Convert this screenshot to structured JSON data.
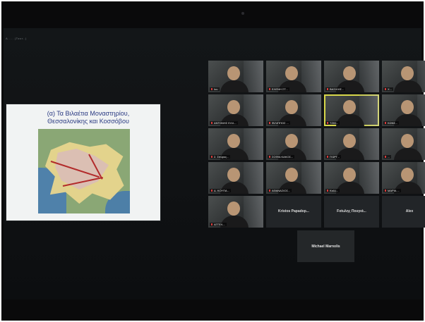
{
  "window": {
    "top_text": "Α..... (Ταυτ..)"
  },
  "shared_screen": {
    "slide_title": "(α) Τα Βιλαέτια Μοναστηρίου, Θεσσαλονίκης και Κοσσόβου"
  },
  "gallery": {
    "tiles": [
      {
        "label": "Ιου",
        "kind": "video",
        "active": false
      },
      {
        "label": "ΕΛΕΝΗ ΣΤ...",
        "kind": "video",
        "active": false
      },
      {
        "label": "ΒΑΣΙΛΗΣ...",
        "kind": "video",
        "active": false
      },
      {
        "label": "Χ...",
        "kind": "video",
        "active": false
      },
      {
        "label": "ΑΝΤΩΝΗΣ ΕΛΛ...",
        "kind": "video",
        "active": false
      },
      {
        "label": "ΦΙΛΙΠΠΟΣ ...",
        "kind": "video",
        "active": false
      },
      {
        "label": "ΤΖΙΩ...",
        "kind": "video",
        "active": true
      },
      {
        "label": "ΚΩΝΣ...",
        "kind": "video",
        "active": false
      },
      {
        "label": "2. Σπύρος...",
        "kind": "video",
        "active": false
      },
      {
        "label": "ΣΟΦΙΑ ΚΑΚΟΣ...",
        "kind": "video",
        "active": false
      },
      {
        "label": "ΓΙΩΡΓ...",
        "kind": "video",
        "active": false
      },
      {
        "label": "...",
        "kind": "video",
        "active": false
      },
      {
        "label": "Δ. ΚΟΥΠΑ...",
        "kind": "video",
        "active": false
      },
      {
        "label": "ΑΘΑΝΑΣΙΟΣ...",
        "kind": "video",
        "active": false
      },
      {
        "label": "Καλλ...",
        "kind": "video",
        "active": false
      },
      {
        "label": "ΜΑΡΙΑ ...",
        "kind": "video",
        "active": false
      },
      {
        "label": "ΑΓΓΕΛ...",
        "kind": "video",
        "active": false
      },
      {
        "label": "Kristos Papadop...",
        "kind": "dark",
        "active": false
      },
      {
        "label": "Fotuλης Πουγιά...",
        "kind": "dark",
        "active": false
      },
      {
        "label": "Alex",
        "kind": "dark",
        "active": false
      }
    ],
    "solo_tile": {
      "label": "Michael Marnolis"
    }
  },
  "colors": {
    "screen_bg": "#111315",
    "active_border": "#d7d74a",
    "slide_title": "#2a3a82"
  }
}
